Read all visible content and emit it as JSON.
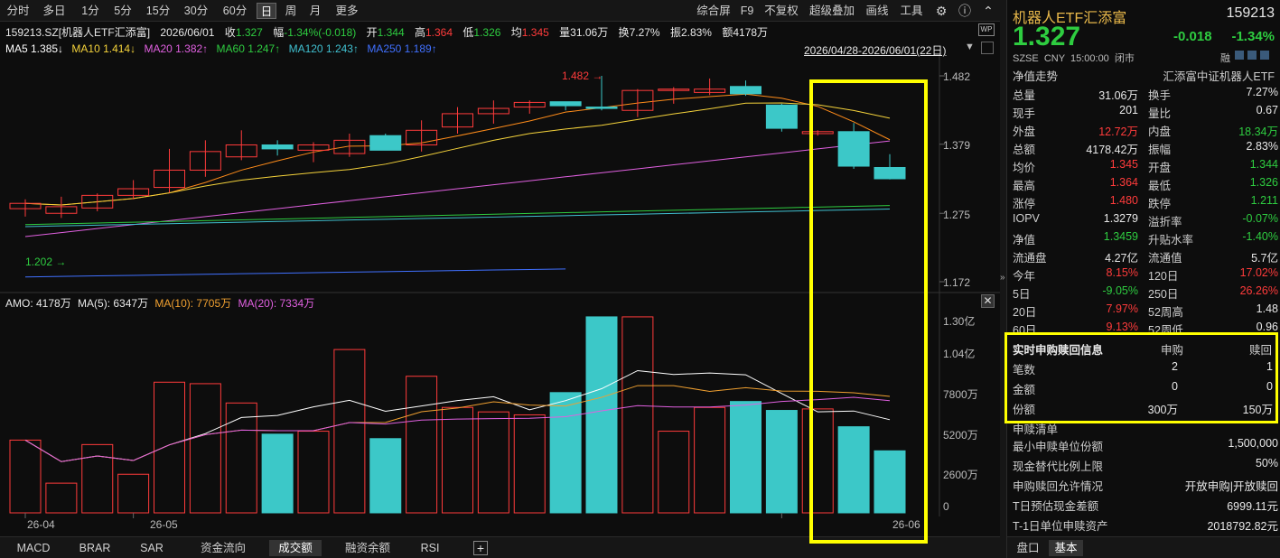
{
  "toolbar": {
    "periods": [
      "分时",
      "多日",
      "1分",
      "5分",
      "15分",
      "30分",
      "60分",
      "日",
      "周",
      "月",
      "更多"
    ],
    "active_period": "日",
    "right_items": [
      "综合屏",
      "F9",
      "不复权",
      "超级叠加",
      "画线",
      "工具"
    ]
  },
  "header": {
    "code_name": "159213.SZ[机器人ETF汇添富]",
    "date": "2026/06/01",
    "close_label": "收",
    "close": "1.327",
    "change_label": "幅",
    "change": "-1.34%(-0.018)",
    "open_label": "开",
    "open": "1.344",
    "high_label": "高",
    "high": "1.364",
    "low_label": "低",
    "low": "1.326",
    "avg_label": "均",
    "avg": "1.345",
    "vol_label": "量",
    "vol": "31.06万",
    "turn_label": "换",
    "turn": "7.27%",
    "amp_label": "振",
    "amp": "2.83%",
    "amt_label": "额",
    "amt": "4178万",
    "range": "2026/04/28-2026/06/01(22日)"
  },
  "ma_line": {
    "ma5": "MA5 1.385↓",
    "ma10": "MA10 1.414↓",
    "ma20": "MA20 1.382↑",
    "ma60": "MA60 1.247↑",
    "ma120": "MA120 1.243↑",
    "ma250": "MA250 1.189↑"
  },
  "price_axis": [
    "1.482",
    "1.379",
    "1.275",
    "1.172"
  ],
  "price_annot": {
    "high": "1.482",
    "low": "1.202"
  },
  "amo_header": {
    "amo": "AMO: 4178万",
    "ma5": "MA(5): 6347万",
    "ma10": "MA(10): 7705万",
    "ma20": "MA(20): 7334万"
  },
  "vol_axis": [
    "1.30亿",
    "1.04亿",
    "7800万",
    "5200万",
    "2600万",
    "0"
  ],
  "date_axis": [
    "26-04",
    "26-05",
    "26-06"
  ],
  "bottom_tabs": [
    "MACD",
    "BRAR",
    "SAR",
    "资金流向",
    "成交额",
    "融资余额",
    "RSI"
  ],
  "active_bottom_tab": "成交额",
  "colors": {
    "up": "#ff3b3b",
    "down": "#3cc8c8",
    "highlight": "#ffff00"
  },
  "chart_data": {
    "type": "candlestick",
    "ylim": [
      1.16,
      1.5
    ],
    "candles": [
      {
        "o": 1.282,
        "h": 1.296,
        "l": 1.27,
        "c": 1.29,
        "amt": 4900
      },
      {
        "o": 1.275,
        "h": 1.3,
        "l": 1.268,
        "c": 1.285,
        "amt": 2000
      },
      {
        "o": 1.283,
        "h": 1.305,
        "l": 1.278,
        "c": 1.302,
        "amt": 4600
      },
      {
        "o": 1.302,
        "h": 1.325,
        "l": 1.296,
        "c": 1.312,
        "amt": 2600
      },
      {
        "o": 1.314,
        "h": 1.372,
        "l": 1.306,
        "c": 1.34,
        "amt": 8800
      },
      {
        "o": 1.34,
        "h": 1.385,
        "l": 1.33,
        "c": 1.368,
        "amt": 8700
      },
      {
        "o": 1.36,
        "h": 1.4,
        "l": 1.355,
        "c": 1.378,
        "amt": 7400
      },
      {
        "o": 1.378,
        "h": 1.385,
        "l": 1.362,
        "c": 1.372,
        "amt": 5300
      },
      {
        "o": 1.37,
        "h": 1.382,
        "l": 1.352,
        "c": 1.378,
        "amt": 5500
      },
      {
        "o": 1.365,
        "h": 1.395,
        "l": 1.36,
        "c": 1.385,
        "amt": 11000
      },
      {
        "o": 1.392,
        "h": 1.395,
        "l": 1.37,
        "c": 1.37,
        "amt": 5000
      },
      {
        "o": 1.378,
        "h": 1.415,
        "l": 1.368,
        "c": 1.4,
        "amt": 9200
      },
      {
        "o": 1.405,
        "h": 1.435,
        "l": 1.395,
        "c": 1.425,
        "amt": 7100
      },
      {
        "o": 1.425,
        "h": 1.445,
        "l": 1.41,
        "c": 1.433,
        "amt": 6800
      },
      {
        "o": 1.435,
        "h": 1.445,
        "l": 1.425,
        "c": 1.442,
        "amt": 6600
      },
      {
        "o": 1.443,
        "h": 1.44,
        "l": 1.43,
        "c": 1.437,
        "amt": 8100
      },
      {
        "o": 1.435,
        "h": 1.482,
        "l": 1.43,
        "c": 1.433,
        "amt": 13200
      },
      {
        "o": 1.43,
        "h": 1.462,
        "l": 1.42,
        "c": 1.46,
        "amt": 13200
      },
      {
        "o": 1.462,
        "h": 1.465,
        "l": 1.44,
        "c": 1.462,
        "amt": 5500
      },
      {
        "o": 1.457,
        "h": 1.478,
        "l": 1.453,
        "c": 1.462,
        "amt": 7100
      },
      {
        "o": 1.466,
        "h": 1.475,
        "l": 1.452,
        "c": 1.455,
        "amt": 7500
      },
      {
        "o": 1.438,
        "h": 1.44,
        "l": 1.398,
        "c": 1.403,
        "amt": 6900
      },
      {
        "o": 1.395,
        "h": 1.4,
        "l": 1.392,
        "c": 1.398,
        "amt": 7000
      },
      {
        "o": 1.398,
        "h": 1.411,
        "l": 1.342,
        "c": 1.346,
        "amt": 5800
      },
      {
        "o": 1.344,
        "h": 1.364,
        "l": 1.326,
        "c": 1.327,
        "amt": 4178
      }
    ]
  },
  "right_panel": {
    "title": "机器人ETF汇添富",
    "code": "159213",
    "price": "1.327",
    "chg": "-0.018",
    "chg_pct": "-1.34%",
    "meta": "SZSE  CNY  15:00:00  闭市",
    "rong": "融",
    "nav_title": "净值走势",
    "nav_name": "汇添富中证机器人ETF",
    "rows": [
      {
        "l1": "总量",
        "v1": "31.06万",
        "c1": "white",
        "l2": "换手",
        "v2": "7.27%",
        "c2": "white"
      },
      {
        "l1": "现手",
        "v1": "201",
        "c1": "white",
        "l2": "量比",
        "v2": "0.67",
        "c2": "white"
      },
      {
        "l1": "外盘",
        "v1": "12.72万",
        "c1": "red",
        "l2": "内盘",
        "v2": "18.34万",
        "c2": "green"
      },
      {
        "l1": "总额",
        "v1": "4178.42万",
        "c1": "white",
        "l2": "振幅",
        "v2": "2.83%",
        "c2": "white"
      },
      {
        "l1": "均价",
        "v1": "1.345",
        "c1": "red",
        "l2": "开盘",
        "v2": "1.344",
        "c2": "green"
      },
      {
        "l1": "最高",
        "v1": "1.364",
        "c1": "red",
        "l2": "最低",
        "v2": "1.326",
        "c2": "green"
      },
      {
        "l1": "涨停",
        "v1": "1.480",
        "c1": "red",
        "l2": "跌停",
        "v2": "1.211",
        "c2": "green"
      },
      {
        "l1": "IOPV",
        "v1": "1.3279",
        "c1": "white",
        "l2": "溢折率",
        "v2": "-0.07%",
        "c2": "green"
      },
      {
        "l1": "净值",
        "v1": "1.3459",
        "c1": "green",
        "l2": "升贴水率",
        "v2": "-1.40%",
        "c2": "green"
      },
      {
        "l1": "流通盘",
        "v1": "4.27亿",
        "c1": "white",
        "l2": "流通值",
        "v2": "5.7亿",
        "c2": "white"
      },
      {
        "l1": "今年",
        "v1": "8.15%",
        "c1": "red",
        "l2": "120日",
        "v2": "17.02%",
        "c2": "red"
      },
      {
        "l1": "5日",
        "v1": "-9.05%",
        "c1": "green",
        "l2": "250日",
        "v2": "26.26%",
        "c2": "red"
      },
      {
        "l1": "20日",
        "v1": "7.97%",
        "c1": "red",
        "l2": "52周高",
        "v2": "1.48",
        "c2": "white"
      },
      {
        "l1": "60日",
        "v1": "9.13%",
        "c1": "red",
        "l2": "52周低",
        "v2": "0.96",
        "c2": "white"
      }
    ],
    "sub": {
      "title": "实时申购赎回信息",
      "col1": "申购",
      "col2": "赎回",
      "rows": [
        {
          "l": "笔数",
          "a": "2",
          "b": "1"
        },
        {
          "l": "金额",
          "a": "0",
          "b": "0"
        },
        {
          "l": "份额",
          "a": "300万",
          "b": "150万"
        }
      ]
    },
    "list_title": "申赎清单",
    "list": [
      {
        "l": "最小申赎单位份额",
        "v": "1,500,000"
      },
      {
        "l": "现金替代比例上限",
        "v": "50%"
      },
      {
        "l": "申购赎回允许情况",
        "v": "开放申购|开放赎回"
      },
      {
        "l": "T日预估现金差额",
        "v": "6999.11元"
      },
      {
        "l": "T-1日单位申赎资产",
        "v": "2018792.82元"
      }
    ],
    "tabs": [
      "盘口",
      "基本"
    ],
    "active_tab": "基本"
  }
}
